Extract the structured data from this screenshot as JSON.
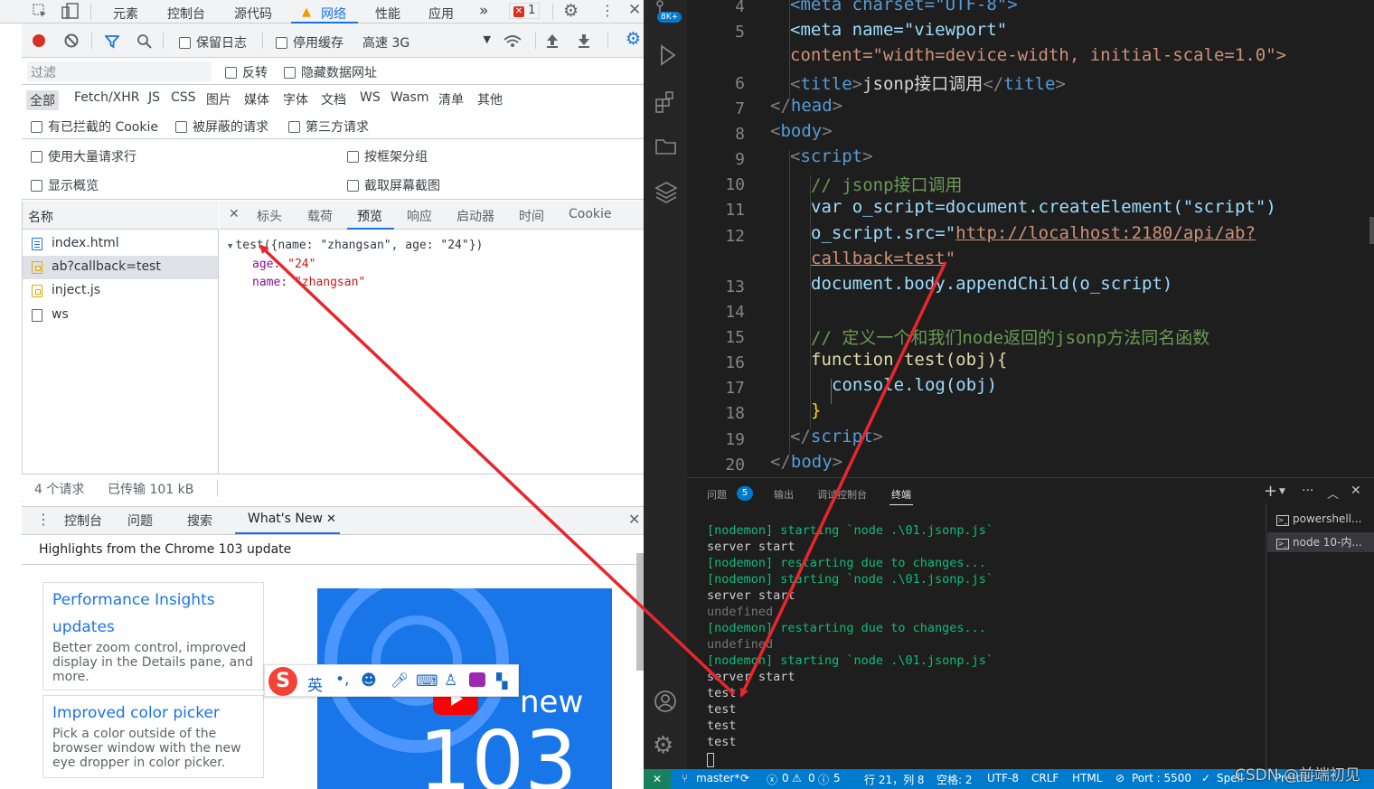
{
  "devtools": {
    "main_tabs": [
      "元素",
      "控制台",
      "源代码",
      "网络",
      "性能",
      "应用"
    ],
    "more_tabs": "»",
    "error_count": "1",
    "toolbar": {
      "preserve_log": "保留日志",
      "disable_cache": "停用缓存",
      "throttle": "高速 3G"
    },
    "filter": {
      "placeholder": "过滤",
      "invert": "反转",
      "hide_data_urls": "隐藏数据网址"
    },
    "type_filters": [
      "全部",
      "Fetch/XHR",
      "JS",
      "CSS",
      "图片",
      "媒体",
      "字体",
      "文档",
      "WS",
      "Wasm",
      "清单",
      "其他"
    ],
    "extra_filters": [
      "有已拦截的 Cookie",
      "被屏蔽的请求",
      "第三方请求"
    ],
    "options": {
      "large_rows": "使用大量请求行",
      "group_by_frame": "按框架分组",
      "show_overview": "显示概览",
      "capture_screenshots": "截取屏幕截图"
    },
    "name_header": "名称",
    "requests": [
      "index.html",
      "ab?callback=test",
      "inject.js",
      "ws"
    ],
    "panel_tabs": [
      "标头",
      "载荷",
      "预览",
      "响应",
      "启动器",
      "时间",
      "Cookie"
    ],
    "preview": {
      "summary": "test({name: \"zhangsan\", age: \"24\"})",
      "rows": [
        {
          "key": "age",
          "value": "\"24\""
        },
        {
          "key": "name",
          "value": "\"zhangsan\""
        }
      ]
    },
    "status": {
      "requests": "4 个请求",
      "transferred": "已传输 101 kB"
    },
    "drawer_tabs": [
      "控制台",
      "问题",
      "搜索",
      "What's New"
    ],
    "whats_new_header": "Highlights from the Chrome 103 update",
    "cards": [
      {
        "title": "Performance Insights updates",
        "desc": "Better zoom control, improved display in the Details pane, and more."
      },
      {
        "title": "Improved color picker",
        "desc": "Pick a color outside of the browser window with the new eye dropper in color picker."
      }
    ],
    "video": {
      "new_label": "new",
      "version": "103"
    },
    "ime_label": "英"
  },
  "vscode": {
    "badge": "8K+",
    "line_numbers": [
      "4",
      "5",
      "",
      "6",
      "7",
      "8",
      "9",
      "10",
      "11",
      "12",
      "",
      "13",
      "14",
      "15",
      "16",
      "17",
      "18",
      "19",
      "20"
    ],
    "code": {
      "l4": "<meta charset=\"UTF-8\">",
      "l5a": "<meta name=\"viewport\"",
      "l5b": "content=\"width=device-width, initial-scale=1.0\">",
      "l6_title": "jsonp接口调用",
      "l10": "// jsonp接口调用",
      "l11": "var o_script=document.createElement(\"script\")",
      "l12a": "o_script.src=\"",
      "l12url1": "http://localhost:2180/api/ab?",
      "l12url2": "callback=test",
      "l13": "document.body.appendChild(o_script)",
      "l15": "// 定义一个和我们node返回的jsonp方法同名函数",
      "l16": "function test(obj){",
      "l17": "console.log(obj)",
      "l18": "}"
    },
    "panel_tabs": [
      "问题",
      "输出",
      "调试控制台",
      "终端"
    ],
    "problems_count": "5",
    "terminal_lines": [
      "[nodemon] starting `node .\\01.jsonp.js`",
      "server start",
      "[nodemon] restarting due to changes...",
      "[nodemon] starting `node .\\01.jsonp.js`",
      "server start",
      "undefined",
      "[nodemon] restarting due to changes...",
      "undefined",
      "[nodemon] starting `node .\\01.jsonp.js`",
      "server start",
      "test",
      "test",
      "test",
      "test"
    ],
    "terminals": [
      "powershell...",
      "node 10-内..."
    ],
    "statusbar": {
      "branch": "master*",
      "errors": "0",
      "warnings": "0",
      "info": "5",
      "position": "行 21，列 8",
      "spaces": "空格: 2",
      "encoding": "UTF-8",
      "eol": "CRLF",
      "language": "HTML",
      "port": "Port : 5500",
      "spell": "Spell",
      "prettier": "Prettier"
    },
    "watermark": "CSDN @前端初见"
  },
  "colors": {
    "arrow": "#e8262c",
    "accent": "#1a73e8",
    "vscode_blue": "#007acc"
  }
}
